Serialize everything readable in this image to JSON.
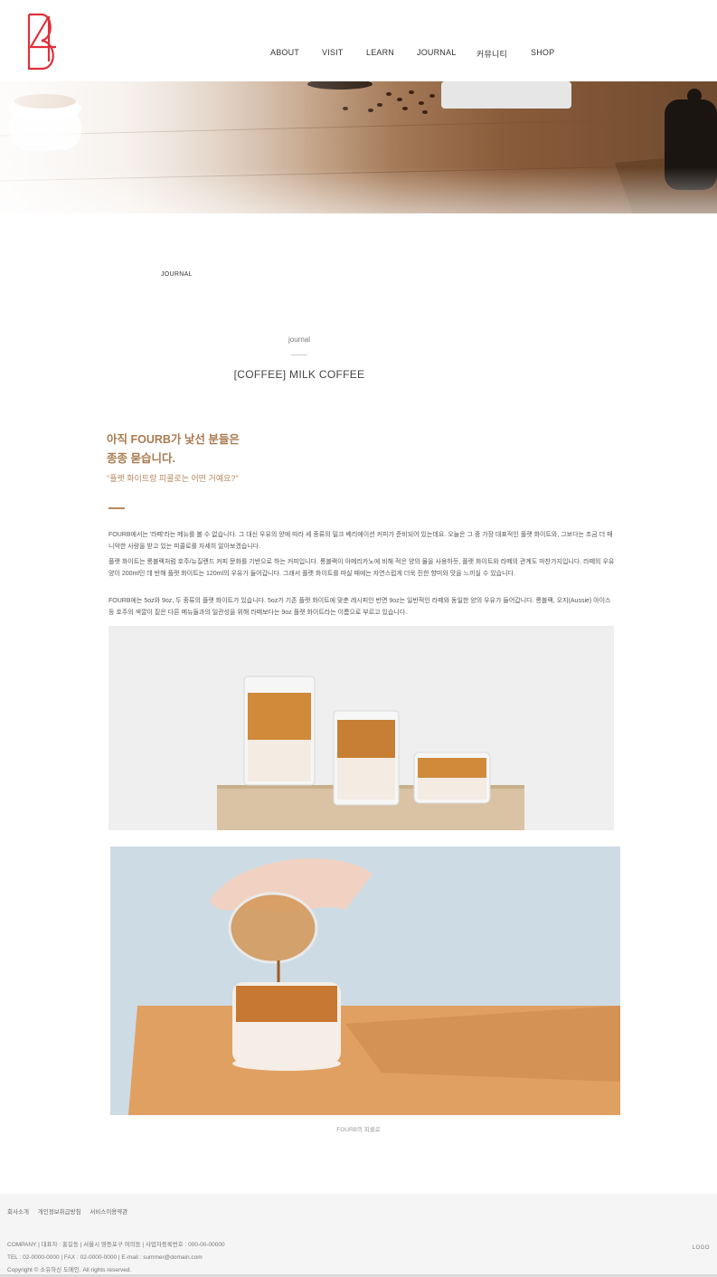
{
  "header": {
    "logo_alt": "4B",
    "nav": [
      "ABOUT",
      "VISIT",
      "LEARN",
      "JOURNAL",
      "커뮤니티",
      "SHOP"
    ]
  },
  "breadcrumb": "JOURNAL",
  "post": {
    "category": "journal",
    "title": "[COFFEE]  MILK COFFEE",
    "intro_line1": "아직 FOURB가 낯선 분들은",
    "intro_line2": "종종 묻습니다.",
    "intro_quote": "\"플랫 화이트랑 피콜로는 어떤 거예요?\"",
    "paragraphs": [
      "FOURB에서는 '라떼'라는 메뉴를 볼 수 없습니다. 그 대신 우유의 양에 따라 세 종류의 밀크 베리에이션 커피가 준비되어 있는데요. 오늘은 그 중 가장 대표적인 플랫 화이트와, 그보다는 조금 더 매니악한 사랑을 받고 있는 피콜로를 자세히 알아보겠습니다.",
      "플랫 화이트는 롱블랙처럼 호주/뉴질랜드 커피 문화를 기반으로 하는 커피입니다. 롱블랙이 아메리카노에 비해 적은 양의 물을 사용하듯, 플랫 화이트와 라떼의 관계도 마찬가지입니다. 라떼의 우유 양이 200ml인 데 반해 플랫 화이트는 120ml의 우유가 들어갑니다. 그래서 플랫 화이트를 마실 때에는 자연스럽게 더욱 진한 향미와 맛을 느끼실 수 있습니다.",
      "FOURB에는 5oz와 9oz, 두 종류의 플랫 화이트가 있습니다. 5oz가 기존 플랫 화이트에 맞춘 레시피인 반면 9oz는 일반적인 라떼와 동일한 양의 우유가 들어갑니다. 롱블랙, 오지(Aussie) 아이스 등 호주의 색깔이 짙은 다른 메뉴들과의 일관성을 위해 라떼보다는 9oz 플랫 화이트라는 이름으로 부르고 있습니다."
    ],
    "photo_caption": "FOURB의 피콜로"
  },
  "footer": {
    "links": [
      "회사소개",
      "개인정보취급방침",
      "서비스이용약관"
    ],
    "info_line1": "COMPANY | 대표자 : 홍길동 | 서울시 영등포구 여의동 | 사업자등록번호 : 000-00-00000",
    "info_line2": "TEL : 02-0000-0000 | FAX : 02-0000-0000 | E-mail : summer@domain.com",
    "copyright": "Copyright © 소유하신 도메인. All rights reserved.",
    "logo_text": "LOGO"
  },
  "colors": {
    "logo_red": "#e0303a",
    "accent_brown": "#a97b4f",
    "footer_bg": "#f5f5f5"
  }
}
